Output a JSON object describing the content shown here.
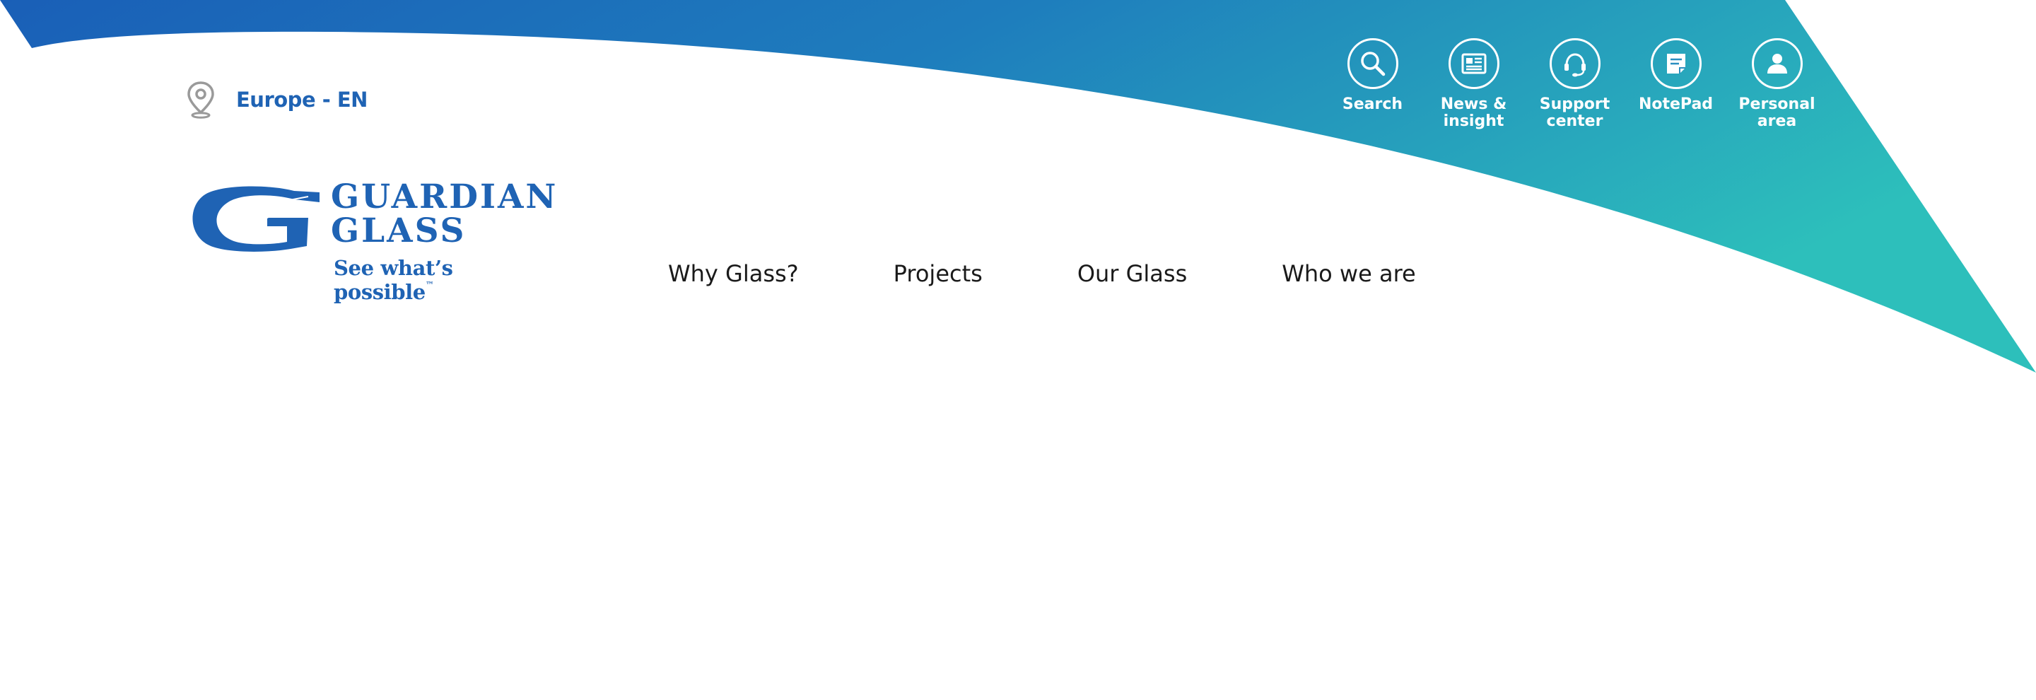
{
  "region": {
    "label": "Europe - EN"
  },
  "utility_nav": [
    {
      "label": "Search",
      "icon": "search-icon"
    },
    {
      "label": "News &\ninsight",
      "icon": "newspaper-icon"
    },
    {
      "label": "Support\ncenter",
      "icon": "headset-icon"
    },
    {
      "label": "NotePad",
      "icon": "notepad-icon"
    },
    {
      "label": "Personal\narea",
      "icon": "user-icon"
    }
  ],
  "logo": {
    "line1": "GUARDIAN",
    "line2": "GLASS",
    "tagline": "See what’s possible",
    "trademark": "™",
    "registered": "®"
  },
  "main_nav": [
    {
      "label": "Why Glass?"
    },
    {
      "label": "Projects"
    },
    {
      "label": "Our Glass"
    },
    {
      "label": "Who we are"
    }
  ],
  "colors": {
    "brand_blue": "#1f63b4",
    "gradient_start": "#1a5fb7",
    "gradient_end": "#2dbfbb",
    "nav_text": "#1a1a1a",
    "background": "#ffffff"
  }
}
